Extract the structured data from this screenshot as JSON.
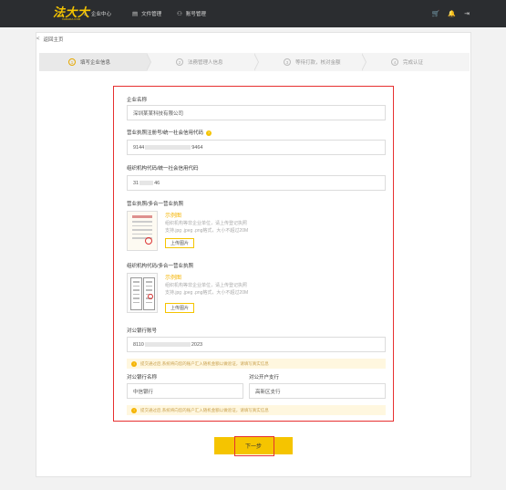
{
  "header": {
    "logo_text": "法大大",
    "logo_sub": "FADADA.COM",
    "nav": [
      {
        "icon": "home-icon",
        "glyph": "⌂",
        "label": "企业中心"
      },
      {
        "icon": "file-icon",
        "glyph": "▤",
        "label": "文件管理"
      },
      {
        "icon": "user-icon",
        "glyph": "⚇",
        "label": "账号管理"
      }
    ],
    "right_icons": {
      "cart": "🛒",
      "bell": "🔔",
      "logout": "⇥"
    }
  },
  "back": {
    "chev": "<",
    "label": "返回主页"
  },
  "steps": [
    {
      "num": "1",
      "label": "填写企业信息"
    },
    {
      "num": "2",
      "label": "法務管理人信息"
    },
    {
      "num": "3",
      "label": "等待打款，核对金额"
    },
    {
      "num": "4",
      "label": "完成认证"
    }
  ],
  "form": {
    "company_name": {
      "label": "企业名称",
      "value": "深圳某某科技有限公司"
    },
    "license_code": {
      "label": "营业执照注册号/统一社会信用代码",
      "help": "?",
      "value_start": "9144",
      "value_end": "9464"
    },
    "org_code": {
      "label": "组织机构代码/统一社会信用代码",
      "value_start": "31",
      "value_end": "46"
    },
    "license_upload": {
      "label": "营业执照/多合一营业执照",
      "sample": "示例图",
      "tip_line1": "组织机构等非企业单位，请上传登记执照",
      "tip_line2": "支持.jpg .jpeg .png格式，大小不超过20M",
      "button": "上传图片"
    },
    "org_upload": {
      "label": "组织机构代码/多合一营业执照",
      "sample": "示例图",
      "tip_line1": "组织机构等非企业单位，请上传登记执照",
      "tip_line2": "支持.jpg .jpeg .png格式，大小不超过20M",
      "button": "上传图片"
    },
    "bank_account": {
      "label": "对公银行账号",
      "value_start": "8110",
      "value_end": "2023"
    },
    "warn1": {
      "icon": "!",
      "text": "提交通过后,系统将向您的账户汇入随机金额以做验证，请填写真实信息"
    },
    "bank_name": {
      "label": "对公银行名称",
      "value": "中信银行"
    },
    "bank_branch": {
      "label": "对公开户支行",
      "value": "高新区支行"
    },
    "warn2": {
      "icon": "!",
      "text": "提交通过后,系统将向您的账户汇入随机金额以做验证，请填写真实信息"
    }
  },
  "next_button": "下一步"
}
